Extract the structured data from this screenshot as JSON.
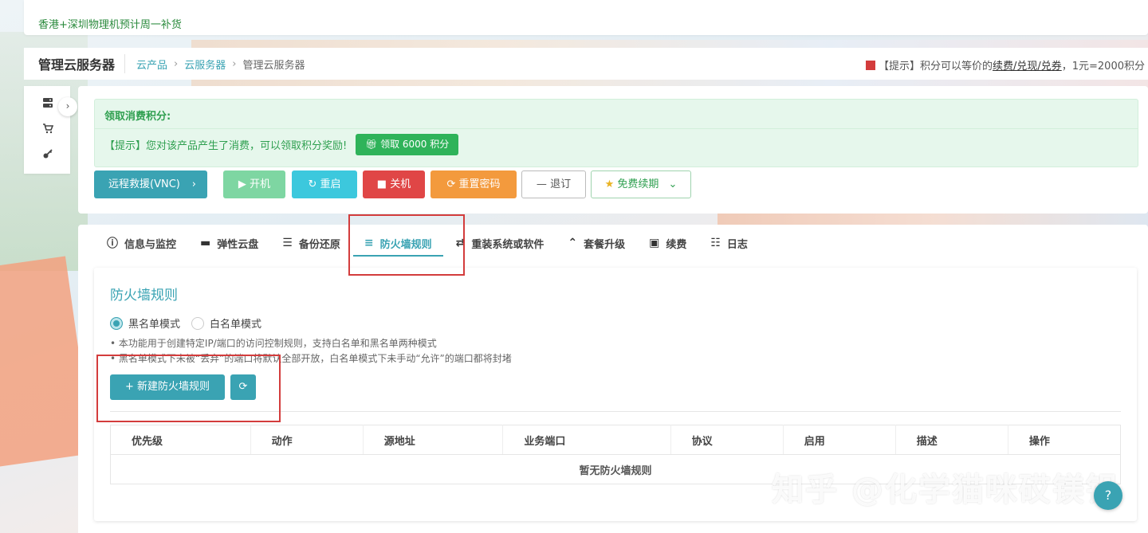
{
  "notice": {
    "text": "香港+深圳物理机预计周一补货"
  },
  "header": {
    "title": "管理云服务器",
    "breadcrumb": [
      "云产品",
      "云服务器",
      "管理云服务器"
    ],
    "tip": {
      "prefix": "【提示】积分可以等价的",
      "link": "续费/兑现/兑券",
      "suffix": "，1元=2000积分"
    }
  },
  "points": {
    "title": "领取消费积分:",
    "hint": "【提示】您对该产品产生了消费，可以领取积分奖励!",
    "claim_label": "领取 6000 积分"
  },
  "actions": {
    "vnc": "远程救援(VNC)",
    "start": "开机",
    "restart": "重启",
    "stop": "关机",
    "reset_pwd": "重置密码",
    "refund": "退订",
    "renew": "免费续期"
  },
  "tabs": [
    {
      "label": "信息与监控",
      "icon": "info-icon"
    },
    {
      "label": "弹性云盘",
      "icon": "disk-icon"
    },
    {
      "label": "备份还原",
      "icon": "backup-icon"
    },
    {
      "label": "防火墙规则",
      "icon": "list-icon",
      "active": true
    },
    {
      "label": "重装系统或软件",
      "icon": "swap-icon"
    },
    {
      "label": "套餐升级",
      "icon": "upgrade-icon"
    },
    {
      "label": "续费",
      "icon": "money-icon"
    },
    {
      "label": "日志",
      "icon": "log-icon"
    }
  ],
  "firewall": {
    "title": "防火墙规则",
    "modes": [
      "黑名单模式",
      "白名单模式"
    ],
    "notes": [
      "本功能用于创建特定IP/端口的访问控制规则，支持白名单和黑名单两种模式",
      "黑名单模式下未被“丢弃”的端口将默认全部开放，白名单模式下未手动“允许”的端口都将封堵"
    ],
    "new_rule_label": "+ 新建防火墙规则",
    "columns": [
      "优先级",
      "动作",
      "源地址",
      "业务端口",
      "协议",
      "启用",
      "描述",
      "操作"
    ],
    "empty_text": "暂无防火墙规则"
  },
  "watermark": "知乎 @化学猫咪砹镁铝",
  "colors": {
    "accent": "#3aa3b3",
    "success": "#2fb35a",
    "danger": "#e04646",
    "warning": "#f39a3d",
    "info": "#3cc8dd",
    "highlight": "#d33c3c"
  }
}
